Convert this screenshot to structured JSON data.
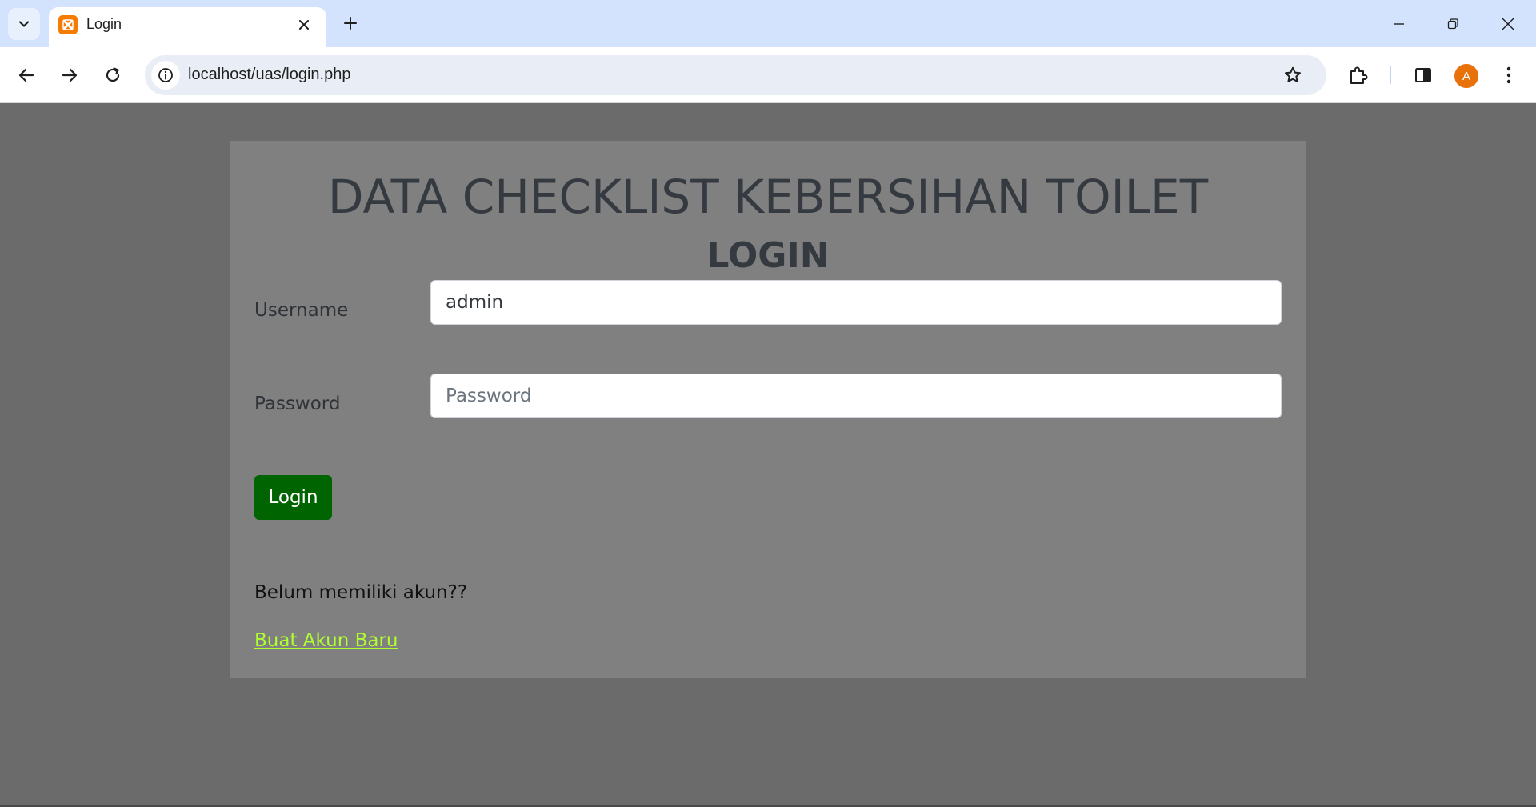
{
  "browser": {
    "tab_title": "Login",
    "url": "localhost/uas/login.php",
    "avatar_letter": "A",
    "colors": {
      "titlebar": "#d3e3fd",
      "favicon": "#f57c00",
      "avatar": "#e8710a"
    }
  },
  "page": {
    "title": "DATA CHECKLIST KEBERSIHAN TOILET",
    "subtitle": "LOGIN",
    "username_label": "Username",
    "username_value": "admin",
    "password_label": "Password",
    "password_placeholder": "Password",
    "login_button": "Login",
    "no_account_text": "Belum memiliki akun??",
    "register_link": "Buat Akun Baru",
    "colors": {
      "background": "#6b6b6b",
      "card": "#808080",
      "button": "#006400",
      "link": "#adff2f",
      "heading": "#343a40"
    }
  }
}
